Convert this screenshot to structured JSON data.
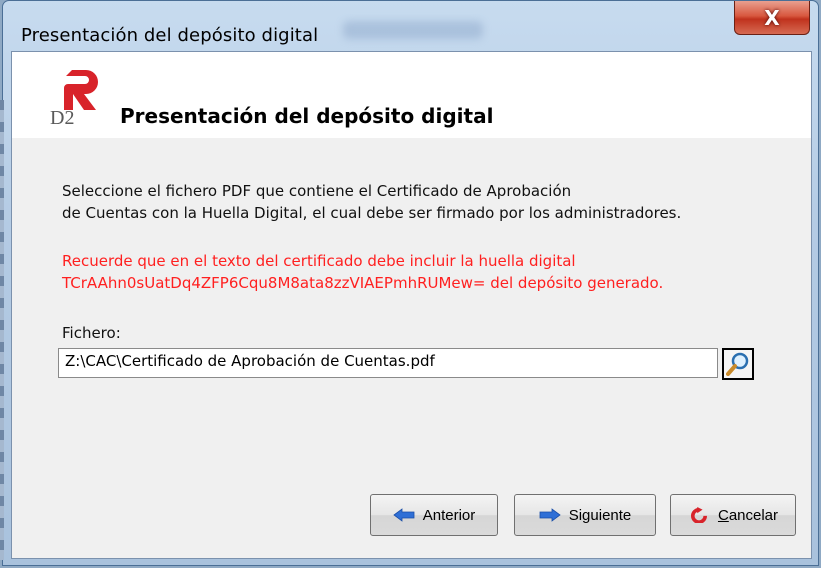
{
  "window": {
    "title": "Presentación del depósito digital",
    "close_label": "X"
  },
  "header": {
    "logo_text": "D2",
    "title": "Presentación del depósito digital"
  },
  "body": {
    "line1": "Seleccione el fichero PDF que contiene el Certificado de Aprobación",
    "line2": "de Cuentas con la Huella Digital, el cual debe ser firmado por los administradores.",
    "warning1": "Recuerde que en el texto del certificado debe incluir la huella digital",
    "warning2": "TCrAAhn0sUatDq4ZFP6Cqu8M8ata8zzVIAEPmhRUMew= del depósito generado.",
    "file_label": "Fichero:",
    "file_value": "Z:\\CAC\\Certificado de Aprobación de Cuentas.pdf"
  },
  "buttons": {
    "previous": "Anterior",
    "next": "Siguiente",
    "cancel_first": "C",
    "cancel_rest": "ancelar"
  },
  "colors": {
    "warning": "#ff2020",
    "logo_red": "#d8232a",
    "arrow_blue": "#2f6fd6"
  },
  "icons": {
    "close": "close-icon",
    "logo": "r-logo-icon",
    "browse": "magnifier-icon",
    "previous": "arrow-left-icon",
    "next": "arrow-right-icon",
    "cancel": "cancel-icon"
  }
}
